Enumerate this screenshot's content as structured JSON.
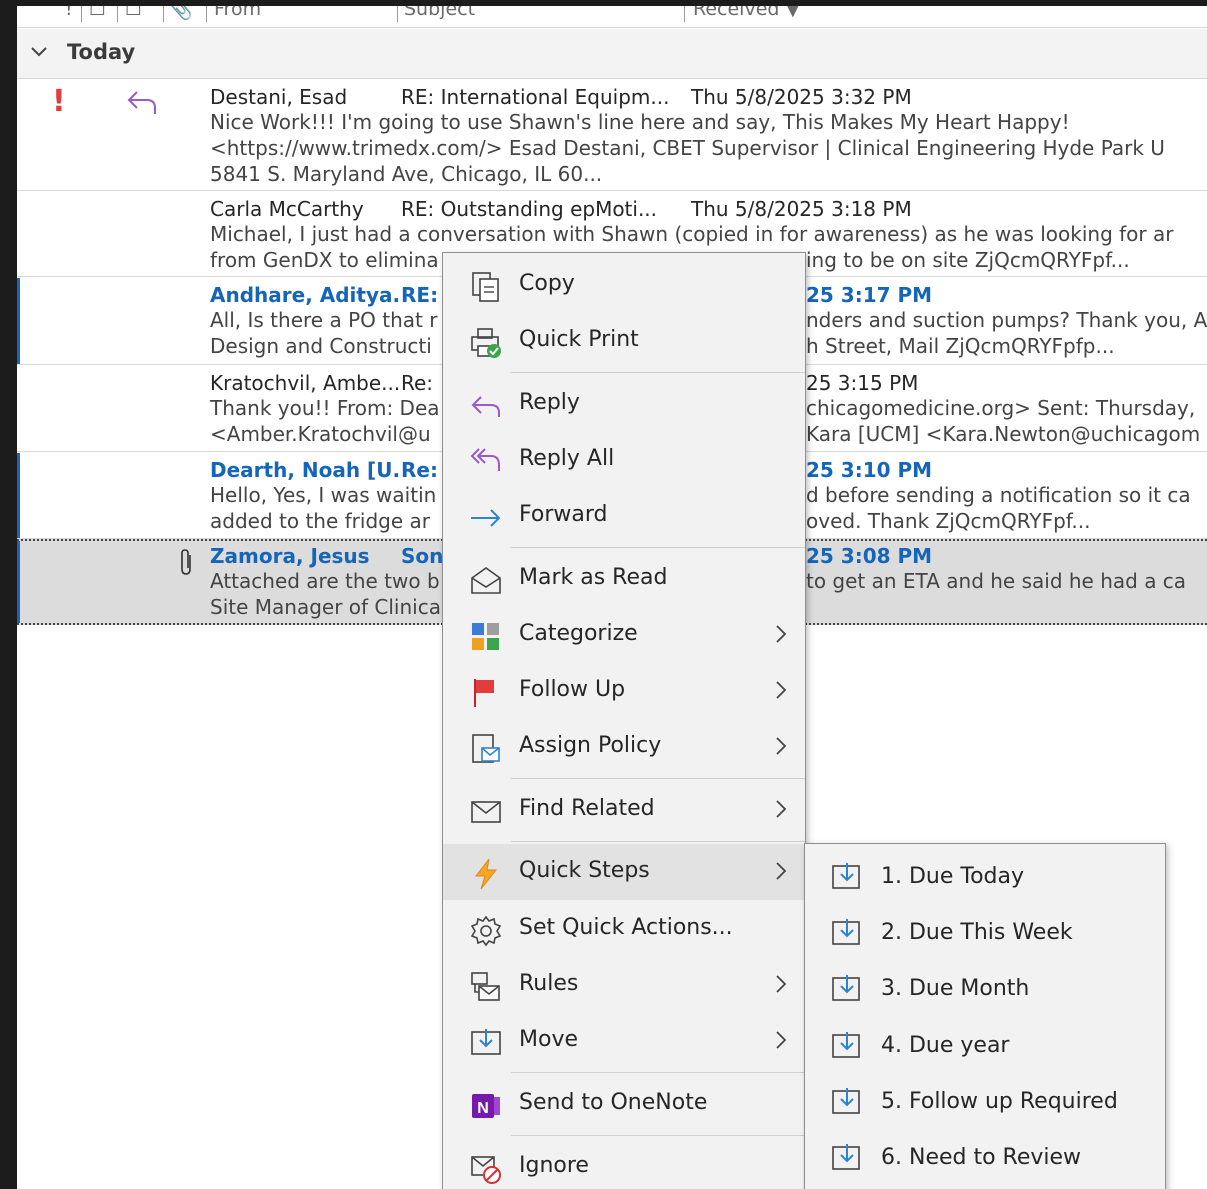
{
  "column_headers": {
    "from": "From",
    "subject": "Subject",
    "received": "Received"
  },
  "group": {
    "label": "Today"
  },
  "messages": [
    {
      "from": "Destani, Esad",
      "subject": "RE: International Equipm...",
      "received": "Thu 5/8/2025 3:32 PM",
      "preview1": "Nice Work!!! I'm going to use Shawn's line here and say, This Makes My Heart Happy!",
      "preview2": " <https://www.trimedx.com/>  Esad Destani, CBET  Supervisor | Clinical Engineering Hyde Park  U",
      "preview3": "5841 S. Maryland Ave, Chicago, IL 60...",
      "importance": "!",
      "status_icon": "reply-arrow-icon"
    },
    {
      "from": "Carla McCarthy",
      "subject": "RE: Outstanding epMoti...",
      "received": "Thu 5/8/2025 3:18 PM",
      "preview1": "Michael, I just had a conversation with Shawn (copied in for awareness) as he was looking for ar",
      "preview2": "from GenDX to elimina",
      "preview2b": "ing to be on site  ZjQcmQRYFpf..."
    },
    {
      "from": "Andhare, Aditya...",
      "subject": "RE:",
      "received": "25 3:17 PM",
      "preview1": "All, Is there a PO that r",
      "preview1b": "nders and suction pumps? Thank you, A",
      "preview2": "Design and Constructi",
      "preview2b": "h Street, Mail  ZjQcmQRYFpfp..."
    },
    {
      "from": "Kratochvil, Ambe...",
      "subject": "Re:",
      "received": "25 3:15 PM",
      "preview1": "Thank you!! From: Dea",
      "preview1b": "chicagomedicine.org> Sent: Thursday,",
      "preview2": "<Amber.Kratochvil@u",
      "preview2b": "Kara [UCM] <Kara.Newton@uchicagom"
    },
    {
      "from": "Dearth, Noah [U...",
      "subject": "Re:",
      "received": "25 3:10 PM",
      "preview1": "Hello, Yes, I was waitin",
      "preview1b": "d before sending a notification so it ca",
      "preview2": "added to the fridge ar",
      "preview2b": "oved. Thank  ZjQcmQRYFpf..."
    },
    {
      "from": "Zamora, Jesus",
      "subject": "Son",
      "received": "25 3:08 PM",
      "preview1": "Attached are the two b",
      "preview1b": "to get an ETA and he said he had a ca",
      "preview2": "Site Manager of Clinica"
    }
  ],
  "context_menu": {
    "items": [
      {
        "label": "Copy",
        "icon": "copy-icon"
      },
      {
        "label": "Quick Print",
        "icon": "quick-print-icon"
      },
      {
        "label": "Reply",
        "icon": "reply-icon"
      },
      {
        "label": "Reply All",
        "icon": "reply-all-icon"
      },
      {
        "label": "Forward",
        "icon": "forward-icon"
      },
      {
        "label": "Mark as Read",
        "icon": "envelope-open-icon"
      },
      {
        "label": "Categorize",
        "icon": "categorize-icon"
      },
      {
        "label": "Follow Up",
        "icon": "flag-icon"
      },
      {
        "label": "Assign Policy",
        "icon": "policy-icon"
      },
      {
        "label": "Find Related",
        "icon": "find-related-icon"
      },
      {
        "label": "Quick Steps",
        "icon": "lightning-icon"
      },
      {
        "label": "Set Quick Actions...",
        "icon": "gear-icon"
      },
      {
        "label": "Rules",
        "icon": "rules-icon"
      },
      {
        "label": "Move",
        "icon": "move-icon"
      },
      {
        "label": "Send to OneNote",
        "icon": "onenote-icon"
      },
      {
        "label": "Ignore",
        "icon": "ignore-icon"
      }
    ]
  },
  "quick_steps_submenu": {
    "items": [
      {
        "label": "1. Due Today"
      },
      {
        "label": "2. Due This Week"
      },
      {
        "label": "3. Due Month"
      },
      {
        "label": "4. Due year"
      },
      {
        "label": "5. Follow up Required"
      },
      {
        "label": "6. Need to Review"
      }
    ]
  },
  "colors": {
    "unread_blue": "#1565b8",
    "importance_red": "#e23c3c",
    "reply_purple": "#9b59c9",
    "menu_bg": "#f2f2f2"
  }
}
